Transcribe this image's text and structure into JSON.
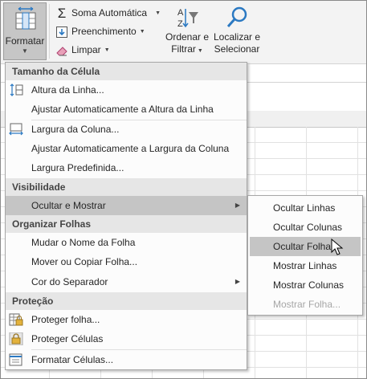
{
  "ribbon": {
    "format_label": "Formatar",
    "autosum_label": "Soma Automática",
    "fill_label": "Preenchimento",
    "clear_label": "Limpar",
    "sort_line1": "Ordenar e",
    "sort_line2": "Filtrar",
    "find_line1": "Localizar e",
    "find_line2": "Selecionar"
  },
  "menu": {
    "header_cell_size": "Tamanho da Célula",
    "row_height": "Altura da Linha...",
    "autofit_row": "Ajustar Automaticamente a Altura da Linha",
    "column_width": "Largura da Coluna...",
    "autofit_column": "Ajustar Automaticamente a Largura da Coluna",
    "default_width": "Largura Predefinida...",
    "header_visibility": "Visibilidade",
    "hide_unhide": "Ocultar e Mostrar",
    "header_organize": "Organizar Folhas",
    "rename_sheet": "Mudar o Nome da Folha",
    "move_copy_sheet": "Mover ou Copiar Folha...",
    "tab_color": "Cor do Separador",
    "header_protection": "Proteção",
    "protect_sheet": "Proteger folha...",
    "lock_cell": "Proteger Células",
    "format_cells": "Formatar Células..."
  },
  "submenu": {
    "hide_rows": "Ocultar Linhas",
    "hide_columns": "Ocultar Colunas",
    "hide_sheet": "Ocultar Folha",
    "unhide_rows": "Mostrar Linhas",
    "unhide_columns": "Mostrar Colunas",
    "unhide_sheet": "Mostrar Folha..."
  },
  "colors": {
    "menu_header_bg": "#e6e6e6",
    "selected_bg": "#c5c5c5",
    "disabled_text": "#a6a6a6",
    "accent_blue": "#2b79c2"
  }
}
